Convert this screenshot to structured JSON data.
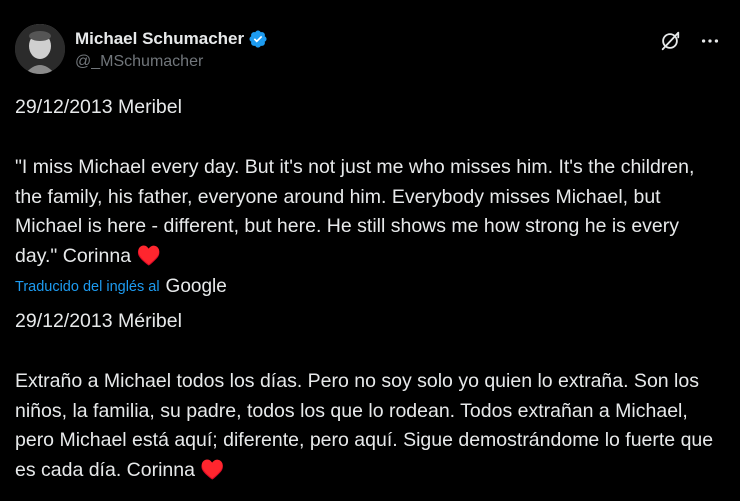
{
  "author": {
    "display_name": "Michael Schumacher",
    "handle": "@_MSchumacher"
  },
  "tweet": {
    "original_date_line": "29/12/2013 Meribel",
    "original_quote": "\"I miss Michael every day. But it's not just me who misses him. It's the children, the family, his father, everyone around him. Everybody misses Michael, but Michael is here - different, but here. He still shows me how strong he is every day.\" Corinna",
    "heart_emoji": "♥️",
    "translation_label": "Traducido del inglés al",
    "translation_provider": "Google",
    "translated_date_line": "29/12/2013 Méribel",
    "translated_text": "Extraño a Michael todos los días. Pero no soy solo yo quien lo extraña. Son los niños, la familia, su padre, todos los que lo rodean. Todos extrañan a Michael, pero Michael está aquí; diferente, pero aquí. Sigue demostrándome lo fuerte que es cada día. Corinna"
  },
  "icons": {
    "verified": "verified-badge-icon",
    "grok": "grok-icon",
    "more": "more-icon"
  },
  "colors": {
    "background": "#000000",
    "text": "#e7e9ea",
    "secondary": "#71767b",
    "link": "#1d9bf0",
    "verified": "#1d9bf0",
    "heart": "#f91880"
  }
}
